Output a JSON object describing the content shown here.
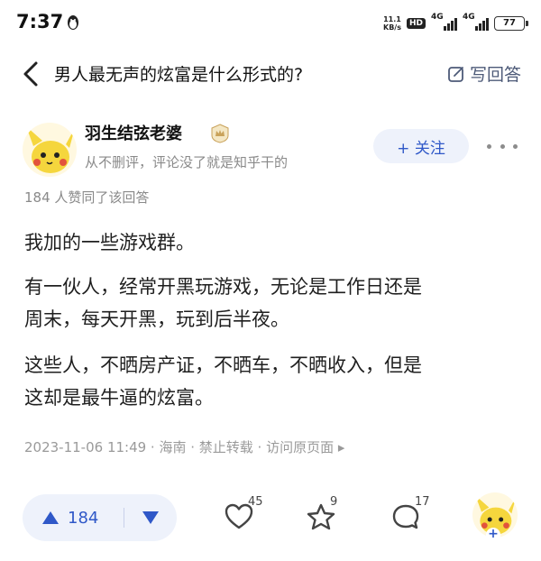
{
  "status_bar": {
    "time": "7:37",
    "net_speed_value": "11.1",
    "net_speed_unit": "KB/s",
    "hd_badge": "HD",
    "signal_1_label": "4G",
    "signal_2_label": "4G",
    "battery": "77"
  },
  "nav": {
    "question_title": "男人最无声的炫富是什么形式的?",
    "write_answer_label": "写回答"
  },
  "author": {
    "name": "羽生结弦老婆",
    "bio": "从不删评，评论没了就是知乎干的",
    "follow_label": "+ 关注"
  },
  "answer": {
    "upvote_summary": "184 人赞同了该回答",
    "paragraph_1": "我加的一些游戏群。",
    "paragraph_2_line_1": "有一伙人，经常开黑玩游戏，无论是工作日还是",
    "paragraph_2_line_2": "周末，每天开黑，玩到后半夜。",
    "paragraph_3_line_1": "这些人，不晒房产证，不晒车，不晒收入，但是",
    "paragraph_3_line_2": "这却是最牛逼的炫富。",
    "meta": "2023-11-06 11:49 · 海南 · 禁止转载 · 访问原页面 ▸"
  },
  "toolbar": {
    "upvote_count": "184",
    "heart_count": "45",
    "favorite_count": "9",
    "comment_count": "17",
    "plus": "+"
  },
  "colors": {
    "accent": "#2f58c8",
    "accent_bg": "#eef2fb",
    "muted_text": "#8a8a8a",
    "avatar_yellow": "#f5d63d"
  }
}
